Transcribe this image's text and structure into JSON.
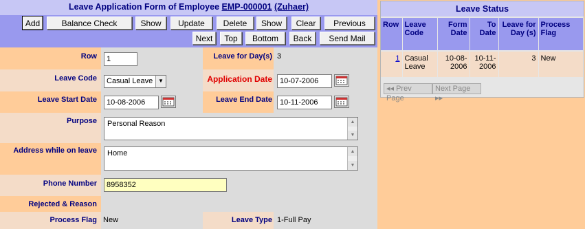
{
  "form": {
    "title_prefix": "Leave Application Form of Employee",
    "emp_id": "EMP-000001",
    "emp_name": "(Zuhaer)"
  },
  "toolbar": {
    "add": "Add",
    "balance_check": "Balance Check",
    "show1": "Show",
    "update": "Update",
    "delete": "Delete",
    "show2": "Show",
    "clear": "Clear",
    "previous": "Previous",
    "next": "Next",
    "top": "Top",
    "bottom": "Bottom",
    "back": "Back",
    "send_mail": "Send Mail"
  },
  "fields": {
    "row_label": "Row",
    "row_value": "1",
    "leave_days_label": "Leave for Day(s)",
    "leave_days_value": "3",
    "leave_code_label": "Leave Code",
    "leave_code_value": "Casual Leave",
    "application_date_label": "Application Date",
    "application_date_value": "10-07-2006",
    "leave_start_label": "Leave Start Date",
    "leave_start_value": "10-08-2006",
    "leave_end_label": "Leave End Date",
    "leave_end_value": "10-11-2006",
    "purpose_label": "Purpose",
    "purpose_value": "Personal Reason",
    "address_label": "Address while on leave",
    "address_value": "Home",
    "phone_label": "Phone Number",
    "phone_value": "8958352",
    "rejected_label": "Rejected & Reason",
    "process_flag_label": "Process Flag",
    "process_flag_value": "New",
    "leave_type_label": "Leave Type",
    "leave_type_value": "1-Full Pay"
  },
  "status": {
    "title": "Leave Status",
    "headers": {
      "row": "Row",
      "leave_code": "Leave Code",
      "form_date": "Form Date",
      "to_date": "To Date",
      "leave_days": "Leave for Day (s)",
      "process_flag": "Process Flag"
    },
    "rows": [
      {
        "row": "1",
        "leave_code": "Casual Leave",
        "form_date": "10-08-2006",
        "to_date": "10-11-2006",
        "leave_days": "3",
        "process_flag": "New"
      }
    ],
    "prev_page": "◂◂ Prev Page",
    "next_page": "Next Page ▸▸"
  },
  "colors": {
    "page_bg": "#ffcc99",
    "header_bg": "#c7c7f5",
    "toolbar_bg": "#9999ee",
    "label_text": "#000080",
    "accent_red": "#e00000",
    "phone_field_bg": "#ffffc0"
  },
  "icons": {
    "calendar": "calendar-icon",
    "dropdown": "chevron-down-icon"
  }
}
